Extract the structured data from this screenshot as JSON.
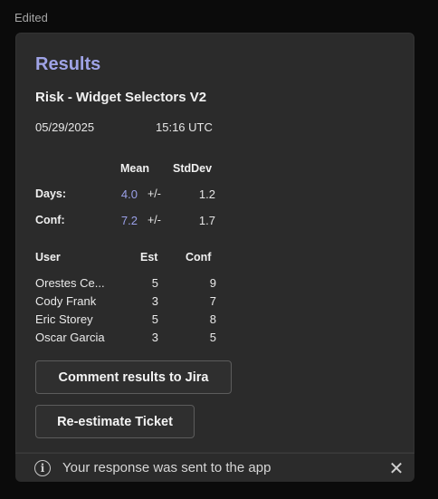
{
  "status": {
    "edited": "Edited"
  },
  "card": {
    "title": "Results",
    "subtitle": "Risk - Widget Selectors V2",
    "date": "05/29/2025",
    "time": "15:16 UTC"
  },
  "stats": {
    "mean_header": "Mean",
    "stddev_header": "StdDev",
    "rows": [
      {
        "label": "Days:",
        "mean": "4.0",
        "pm": "+/-",
        "stddev": "1.2"
      },
      {
        "label": "Conf:",
        "mean": "7.2",
        "pm": "+/-",
        "stddev": "1.7"
      }
    ],
    "accent_color": "#9aa0e8"
  },
  "users": {
    "headers": {
      "user": "User",
      "est": "Est",
      "conf": "Conf"
    },
    "rows": [
      {
        "name": "Orestes Ce...",
        "est": "5",
        "conf": "9"
      },
      {
        "name": "Cody Frank",
        "est": "3",
        "conf": "7"
      },
      {
        "name": "Eric Storey",
        "est": "5",
        "conf": "8"
      },
      {
        "name": "Oscar Garcia",
        "est": "3",
        "conf": "5"
      }
    ]
  },
  "actions": {
    "comment_label": "Comment results to Jira",
    "reestimate_label": "Re-estimate Ticket"
  },
  "banner": {
    "info_icon": "info-icon",
    "info_glyph": "i",
    "text": "Your response was sent to the app",
    "close_icon": "close-icon",
    "close_glyph": "✕"
  }
}
